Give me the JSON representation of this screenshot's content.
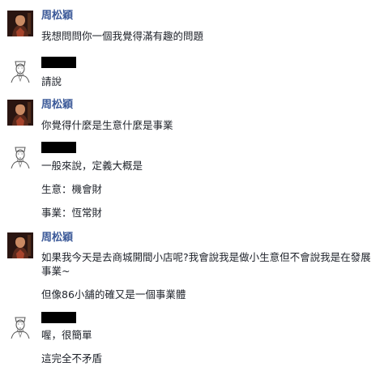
{
  "conversation": {
    "messages": [
      {
        "sender": "周松穎",
        "avatar": "portrait-photo-avatar",
        "lines": [
          "我想問問你一個我覺得滿有趣的問題"
        ]
      },
      {
        "sender": "",
        "sender_redacted": true,
        "avatar": "sketch-portrait-avatar",
        "lines": [
          "請說"
        ]
      },
      {
        "sender": "周松穎",
        "avatar": "portrait-photo-avatar",
        "lines": [
          "你覺得什麼是生意什麼是事業"
        ]
      },
      {
        "sender": "",
        "sender_redacted": true,
        "avatar": "sketch-portrait-avatar",
        "lines": [
          "一般來說，定義大概是",
          "生意：機會財",
          "事業：恆常財"
        ]
      },
      {
        "sender": "周松穎",
        "avatar": "portrait-photo-avatar",
        "lines": [
          "如果我今天是去商城開間小店呢?我會說我是做小生意但不會說我是在發展事業~",
          "但像86小舖的確又是一個事業體"
        ]
      },
      {
        "sender": "",
        "sender_redacted": true,
        "avatar": "sketch-portrait-avatar",
        "lines": [
          "喔，很簡單",
          "這完全不矛盾"
        ]
      }
    ]
  },
  "colors": {
    "sender_name": "#3b5998",
    "message_text": "#1d2129",
    "redaction": "#000000"
  }
}
